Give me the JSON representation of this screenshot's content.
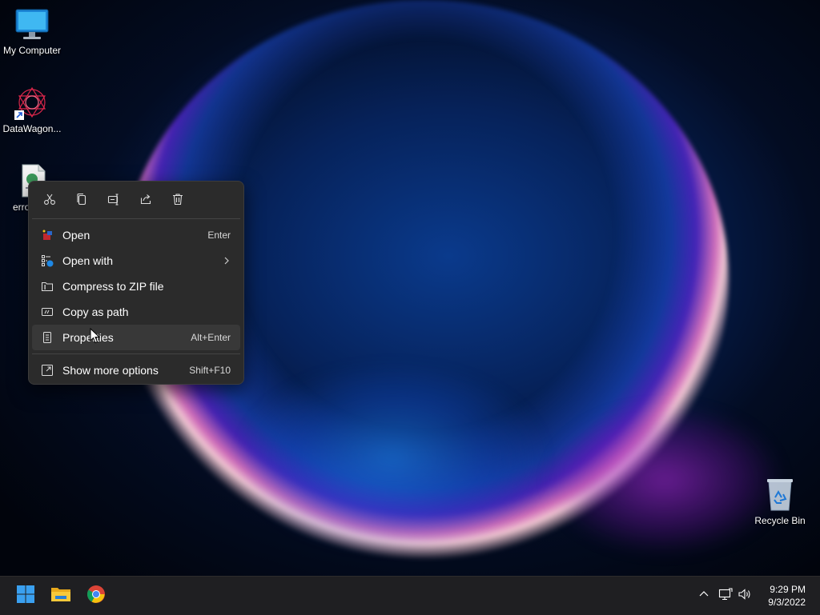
{
  "desktop": {
    "icons": [
      {
        "label": "My Computer"
      },
      {
        "label": "DataWagon..."
      },
      {
        "label": "erro"
      },
      {
        "label": "Recycle Bin"
      }
    ]
  },
  "context_menu": {
    "toolbar": [
      "cut-icon",
      "copy-icon",
      "rename-icon",
      "share-icon",
      "delete-icon"
    ],
    "items": [
      {
        "label": "Open",
        "shortcut": "Enter"
      },
      {
        "label": "Open with",
        "shortcut": ""
      },
      {
        "label": "Compress to ZIP file",
        "shortcut": ""
      },
      {
        "label": "Copy as path",
        "shortcut": ""
      },
      {
        "label": "Properties",
        "shortcut": "Alt+Enter"
      },
      {
        "label": "Show more options",
        "shortcut": "Shift+F10"
      }
    ]
  },
  "taskbar": {
    "time": "9:29 PM",
    "date": "9/3/2022"
  },
  "colors": {
    "menu_bg": "#2b2b2b",
    "taskbar_bg": "#1f1f22",
    "accent": "#0078d4"
  }
}
